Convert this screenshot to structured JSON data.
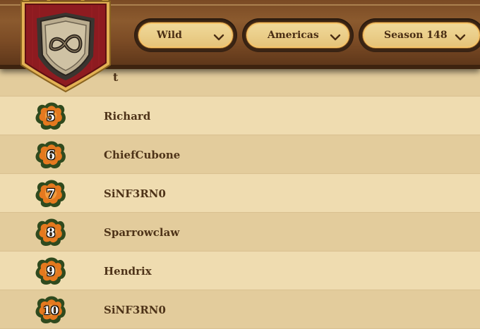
{
  "filters": {
    "mode": "Wild",
    "region": "Americas",
    "season": "Season 148"
  },
  "column_header_partial": "t",
  "rows": [
    {
      "rank": "5",
      "name": "Richard"
    },
    {
      "rank": "6",
      "name": "ChiefCubone"
    },
    {
      "rank": "7",
      "name": "SiNF3RN0"
    },
    {
      "rank": "8",
      "name": "Sparrowclaw"
    },
    {
      "rank": "9",
      "name": "Hendrix"
    },
    {
      "rank": "10",
      "name": "SiNF3RN0"
    }
  ],
  "colors": {
    "wood": "#7a4a24",
    "parchment": "#efdcb0",
    "banner_red": "#8e1b20",
    "gold": "#e8b24c"
  }
}
